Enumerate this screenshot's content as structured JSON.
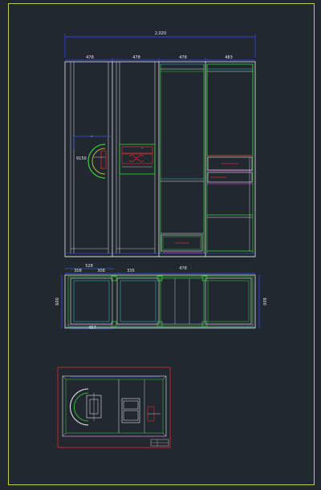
{
  "drawing": {
    "colors": {
      "background": "#212830",
      "border": "#c8c84a",
      "white": "#e6e6e6",
      "green": "#3cd23c",
      "blue": "#3c4cff",
      "cyan": "#32c8c8",
      "magenta": "#c83cc8",
      "red": "#e02828",
      "yellow": "#d8d840"
    },
    "elevation": {
      "overall_width": "2,020",
      "bay_widths": [
        "478",
        "478",
        "478",
        "483"
      ],
      "side_dimension": "9150"
    },
    "plan": {
      "top_dims": [
        "528",
        "308",
        "308",
        "335",
        "478"
      ],
      "left_depth": "600",
      "right_depth": "600",
      "bottom_dim": "457"
    }
  }
}
